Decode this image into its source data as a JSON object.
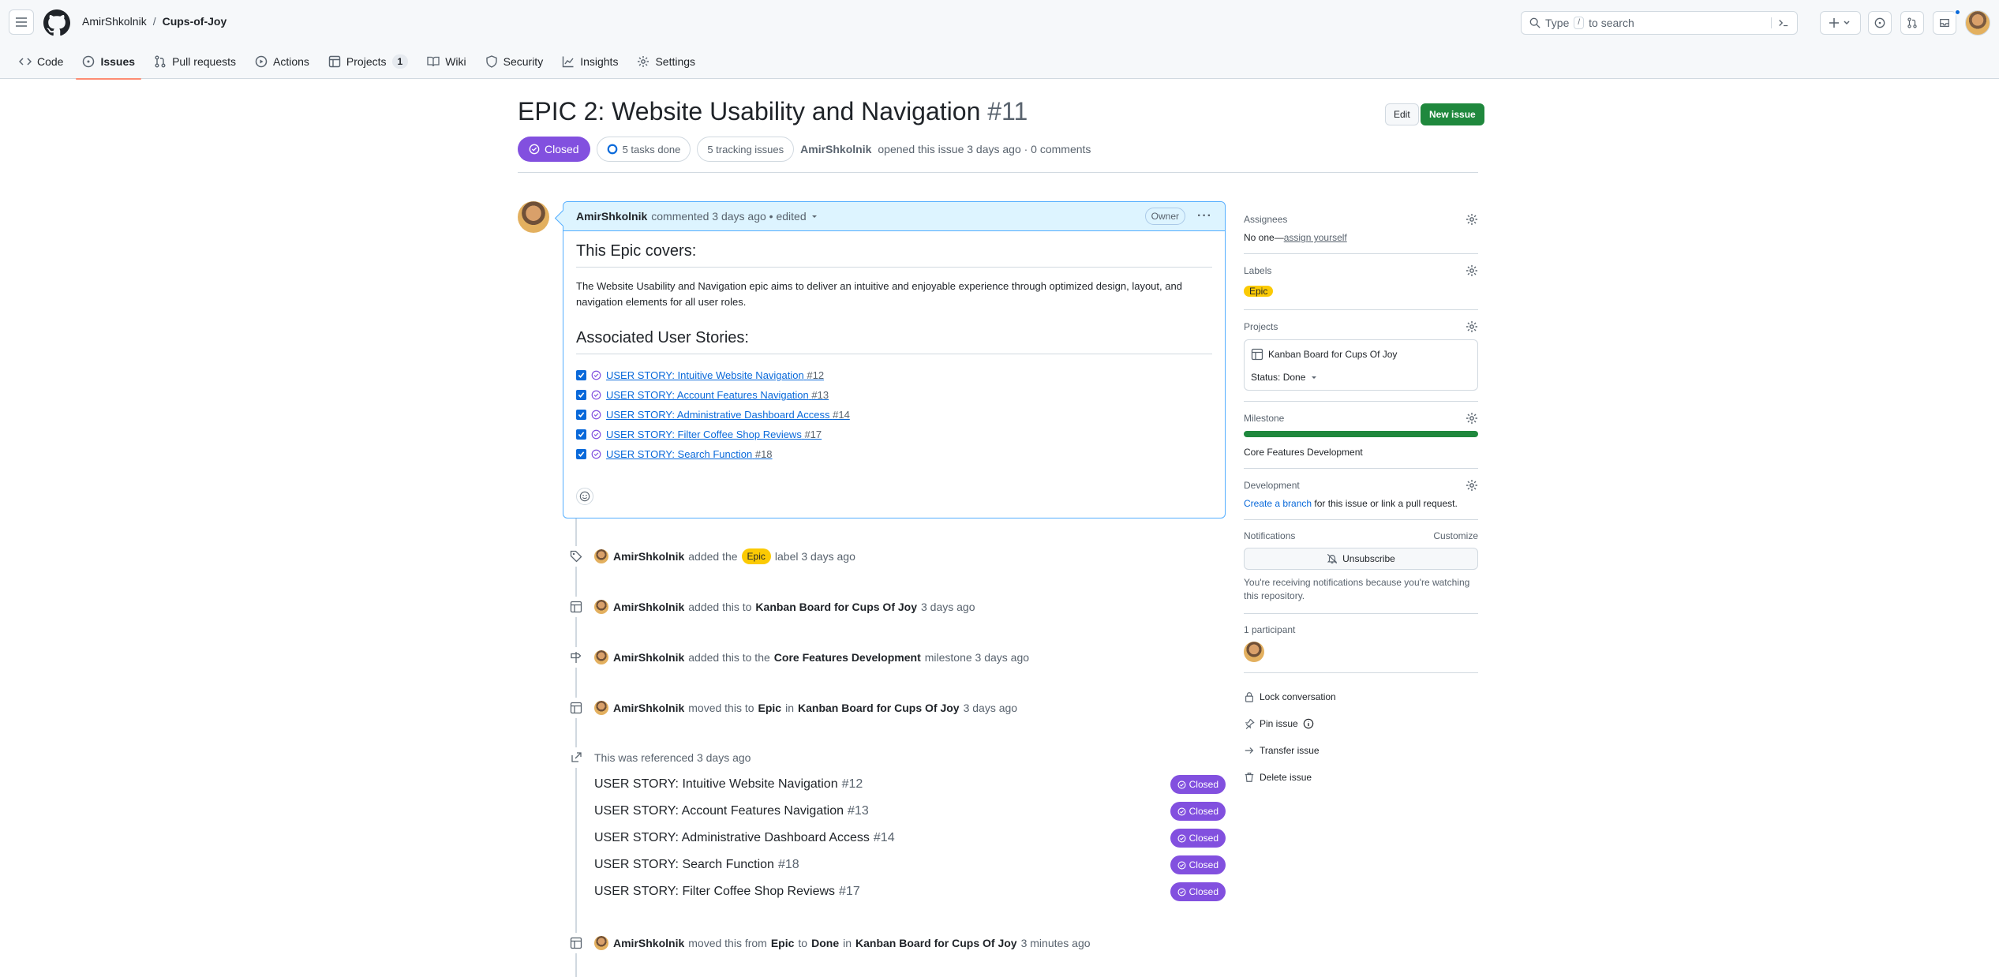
{
  "header": {
    "owner": "AmirShkolnik",
    "separator": "/",
    "repo": "Cups-of-Joy",
    "search_prefix": "Type",
    "search_key": "/",
    "search_suffix": "to search"
  },
  "tabs": [
    {
      "label": "Code",
      "icon": "code-icon"
    },
    {
      "label": "Issues",
      "icon": "issue-opened-icon",
      "selected": true
    },
    {
      "label": "Pull requests",
      "icon": "git-pull-request-icon"
    },
    {
      "label": "Actions",
      "icon": "play-icon"
    },
    {
      "label": "Projects",
      "icon": "table-icon",
      "count": "1"
    },
    {
      "label": "Wiki",
      "icon": "book-icon"
    },
    {
      "label": "Security",
      "icon": "shield-icon"
    },
    {
      "label": "Insights",
      "icon": "graph-icon"
    },
    {
      "label": "Settings",
      "icon": "gear-icon"
    }
  ],
  "issue": {
    "title": "EPIC 2: Website Usability and Navigation",
    "number": "#11",
    "edit_label": "Edit",
    "new_issue_label": "New issue",
    "state": "Closed",
    "tasks_done": "5 tasks done",
    "tracking": "5 tracking issues",
    "author": "AmirShkolnik",
    "opened_text": "opened this issue 3 days ago · 0 comments"
  },
  "comment": {
    "author": "AmirShkolnik",
    "meta": "commented 3 days ago • edited",
    "role": "Owner",
    "heading1": "This Epic covers:",
    "paragraph": "The Website Usability and Navigation epic aims to deliver an intuitive and enjoyable experience through optimized design, layout, and navigation elements for all user roles.",
    "heading2": "Associated User Stories:",
    "tasks": [
      {
        "title": "USER STORY: Intuitive Website Navigation",
        "num": "#12"
      },
      {
        "title": "USER STORY: Account Features Navigation",
        "num": "#13"
      },
      {
        "title": "USER STORY: Administrative Dashboard Access",
        "num": "#14"
      },
      {
        "title": "USER STORY: Filter Coffee Shop Reviews",
        "num": "#17"
      },
      {
        "title": "USER STORY: Search Function",
        "num": "#18"
      }
    ]
  },
  "timeline": {
    "e1": {
      "actor": "AmirShkolnik",
      "a": "added the",
      "label": "Epic",
      "b": "label 3 days ago"
    },
    "e2": {
      "actor": "AmirShkolnik",
      "a": "added this to",
      "target": "Kanban Board for Cups Of Joy",
      "b": "3 days ago"
    },
    "e3": {
      "actor": "AmirShkolnik",
      "a": "added this to the",
      "target": "Core Features Development",
      "b": "milestone 3 days ago"
    },
    "e4": {
      "actor": "AmirShkolnik",
      "a": "moved this to",
      "col": "Epic",
      "in": "in",
      "target": "Kanban Board for Cups Of Joy",
      "b": "3 days ago"
    },
    "ref_text": "This was referenced 3 days ago",
    "refs": [
      {
        "title": "USER STORY: Intuitive Website Navigation",
        "num": "#12",
        "state": "Closed"
      },
      {
        "title": "USER STORY: Account Features Navigation",
        "num": "#13",
        "state": "Closed"
      },
      {
        "title": "USER STORY: Administrative Dashboard Access",
        "num": "#14",
        "state": "Closed"
      },
      {
        "title": "USER STORY: Search Function",
        "num": "#18",
        "state": "Closed"
      },
      {
        "title": "USER STORY: Filter Coffee Shop Reviews",
        "num": "#17",
        "state": "Closed"
      }
    ],
    "e5": {
      "actor": "AmirShkolnik",
      "a": "moved this from",
      "from": "Epic",
      "to_word": "to",
      "to": "Done",
      "in": "in",
      "target": "Kanban Board for Cups Of Joy",
      "b": "3 minutes ago"
    }
  },
  "sidebar": {
    "assignees_label": "Assignees",
    "assignees_none": "No one—",
    "assign_yourself": "assign yourself",
    "labels_label": "Labels",
    "label_epic": "Epic",
    "projects_label": "Projects",
    "project_name": "Kanban Board for Cups Of Joy",
    "project_status": "Status: Done",
    "milestone_label": "Milestone",
    "milestone_progress": 1.0,
    "milestone_name": "Core Features Development",
    "development_label": "Development",
    "create_branch": "Create a branch",
    "development_text": "for this issue or link a pull request.",
    "notifications_label": "Notifications",
    "customize": "Customize",
    "unsubscribe": "Unsubscribe",
    "notif_reason": "You're receiving notifications because you're watching this repository.",
    "participants_label": "1 participant",
    "lock": "Lock conversation",
    "pin": "Pin issue",
    "transfer": "Transfer issue",
    "delete": "Delete issue"
  },
  "colors": {
    "closed": "#8250df",
    "primary": "#1f883d",
    "link": "#0969da",
    "epic": "#fbca04"
  }
}
